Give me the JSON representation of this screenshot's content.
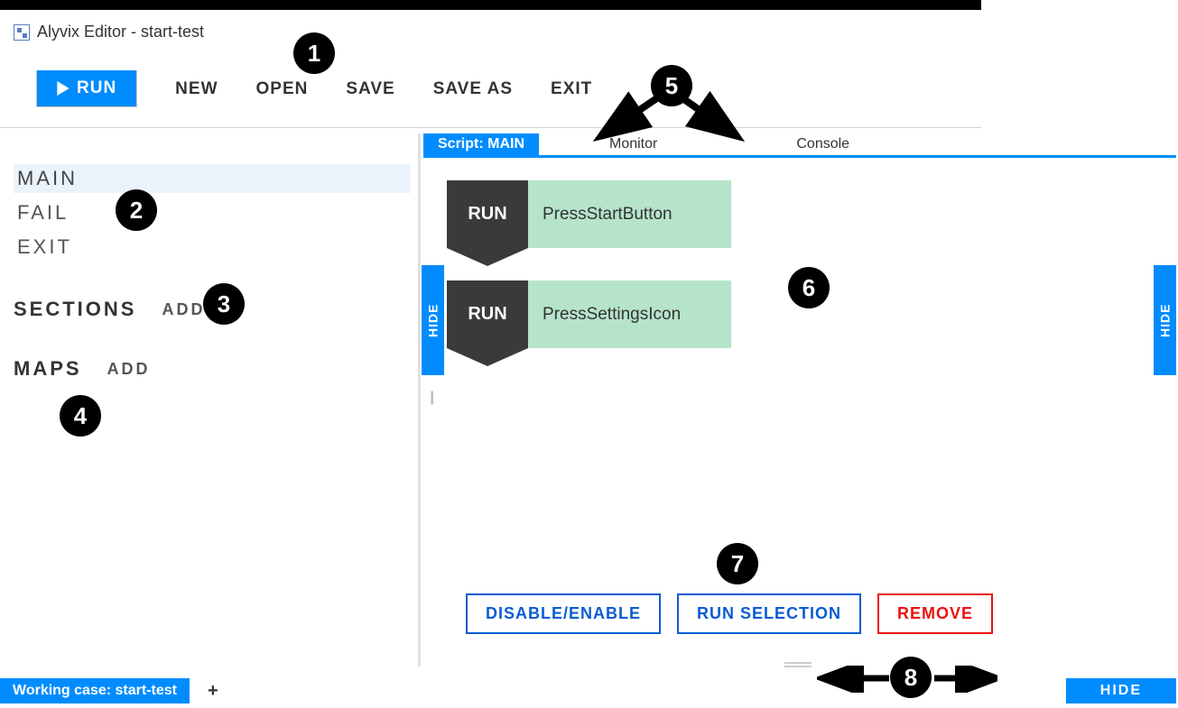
{
  "window": {
    "title": "Alyvix Editor - start-test"
  },
  "toolbar": {
    "run": "RUN",
    "new": "NEW",
    "open": "OPEN",
    "save": "SAVE",
    "save_as": "SAVE AS",
    "exit": "EXIT"
  },
  "left_panel": {
    "scripts": [
      "MAIN",
      "FAIL",
      "EXIT"
    ],
    "selected_script": "MAIN",
    "sections_label": "SECTIONS",
    "sections_add": "ADD",
    "maps_label": "MAPS",
    "maps_add": "ADD"
  },
  "tabs": {
    "script": "Script: MAIN",
    "monitor": "Monitor",
    "console": "Console"
  },
  "hide_label": "HIDE",
  "blocks": [
    {
      "tag": "RUN",
      "name": "PressStartButton"
    },
    {
      "tag": "RUN",
      "name": "PressSettingsIcon"
    }
  ],
  "actions": {
    "disable_enable": "DISABLE/ENABLE",
    "run_selection": "RUN SELECTION",
    "remove": "REMOVE"
  },
  "status": {
    "working_case": "Working case: start-test",
    "plus": "+"
  },
  "callouts": {
    "1": "1",
    "2": "2",
    "3": "3",
    "4": "4",
    "5": "5",
    "6": "6",
    "7": "7",
    "8": "8"
  }
}
